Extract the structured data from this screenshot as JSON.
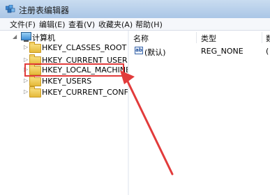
{
  "window": {
    "title": "注册表编辑器",
    "accent_color": "#e23b3b"
  },
  "menu": {
    "items": [
      "文件(F)",
      "编辑(E)",
      "查看(V)",
      "收藏夹(A)",
      "帮助(H)"
    ]
  },
  "tree": {
    "root_label": "计算机",
    "items": [
      {
        "label": "HKEY_CLASSES_ROOT"
      },
      {
        "label": "HKEY_CURRENT_USER"
      },
      {
        "label": "HKEY_LOCAL_MACHINE"
      },
      {
        "label": "HKEY_USERS"
      },
      {
        "label": "HKEY_CURRENT_CONFIG"
      }
    ]
  },
  "list": {
    "columns": [
      "名称",
      "类型",
      "数"
    ],
    "rows": [
      {
        "icon": "string-value-icon",
        "icon_text": "ab",
        "name": "(默认)",
        "type": "REG_NONE",
        "data": "("
      }
    ]
  },
  "annotation": {
    "type": "arrow",
    "color": "#e23b3b",
    "target": "HKEY_LOCAL_MACHINE"
  }
}
